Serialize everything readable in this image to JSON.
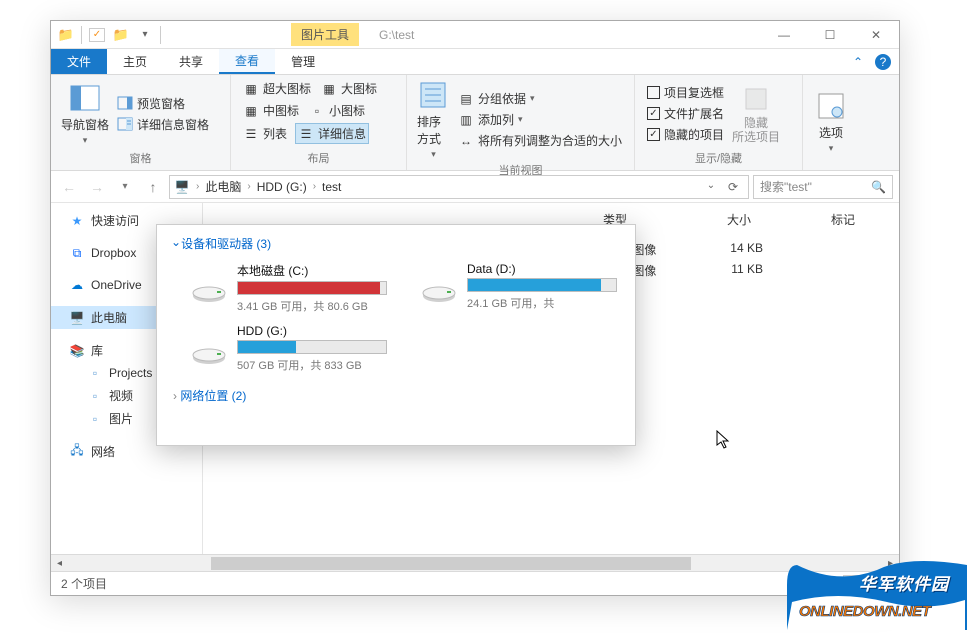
{
  "window": {
    "contextual_tab": "图片工具",
    "title_path": "G:\\test"
  },
  "win_controls": {
    "min": "—",
    "max": "☐",
    "close": "✕"
  },
  "tabs": {
    "file": "文件",
    "home": "主页",
    "share": "共享",
    "view": "查看",
    "manage": "管理"
  },
  "ribbon": {
    "panes": {
      "nav_pane": "导航窗格",
      "preview_pane": "预览窗格",
      "details_pane": "详细信息窗格",
      "label": "窗格"
    },
    "layout": {
      "extra_large": "超大图标",
      "large": "大图标",
      "medium": "中图标",
      "small": "小图标",
      "list": "列表",
      "details": "详细信息",
      "label": "布局"
    },
    "current_view": {
      "sort_by": "排序方式",
      "group_by": "分组依据",
      "add_columns": "添加列",
      "size_columns": "将所有列调整为合适的大小",
      "label": "当前视图"
    },
    "show_hide": {
      "item_checkboxes": "项目复选框",
      "file_ext": "文件扩展名",
      "hidden_items": "隐藏的项目",
      "hide_selected": "隐藏\n所选项目",
      "label": "显示/隐藏"
    },
    "options": "选项"
  },
  "address": {
    "root": "此电脑",
    "drive": "HDD (G:)",
    "folder": "test",
    "search_placeholder": "搜索\"test\""
  },
  "sidebar": {
    "quick_access": "快速访问",
    "dropbox": "Dropbox",
    "onedrive": "OneDrive",
    "this_pc": "此电脑",
    "libraries": "库",
    "projects": "Projects",
    "videos": "视频",
    "pictures": "图片",
    "network": "网络"
  },
  "columns": {
    "type": "类型",
    "size": "大小",
    "tags": "标记"
  },
  "files": [
    {
      "type": "PNG 图像",
      "size": "14 KB"
    },
    {
      "type": "PNG 图像",
      "size": "11 KB"
    }
  ],
  "popup": {
    "devices_header": "设备和驱动器 (3)",
    "drives": [
      {
        "name": "本地磁盘 (C:)",
        "text": "3.41 GB 可用，共 80.6 GB",
        "fill_pct": 96,
        "color": "red"
      },
      {
        "name": "Data (D:)",
        "text": "24.1 GB 可用，共",
        "fill_pct": 90,
        "color": "blue"
      },
      {
        "name": "HDD (G:)",
        "text": "507 GB 可用，共 833 GB",
        "fill_pct": 39,
        "color": "blue"
      }
    ],
    "network_header": "网络位置 (2)"
  },
  "status": {
    "items": "2 个项目"
  },
  "logo": {
    "line1": "华军软件园",
    "line2": "ONLINEDOWN.NET"
  }
}
